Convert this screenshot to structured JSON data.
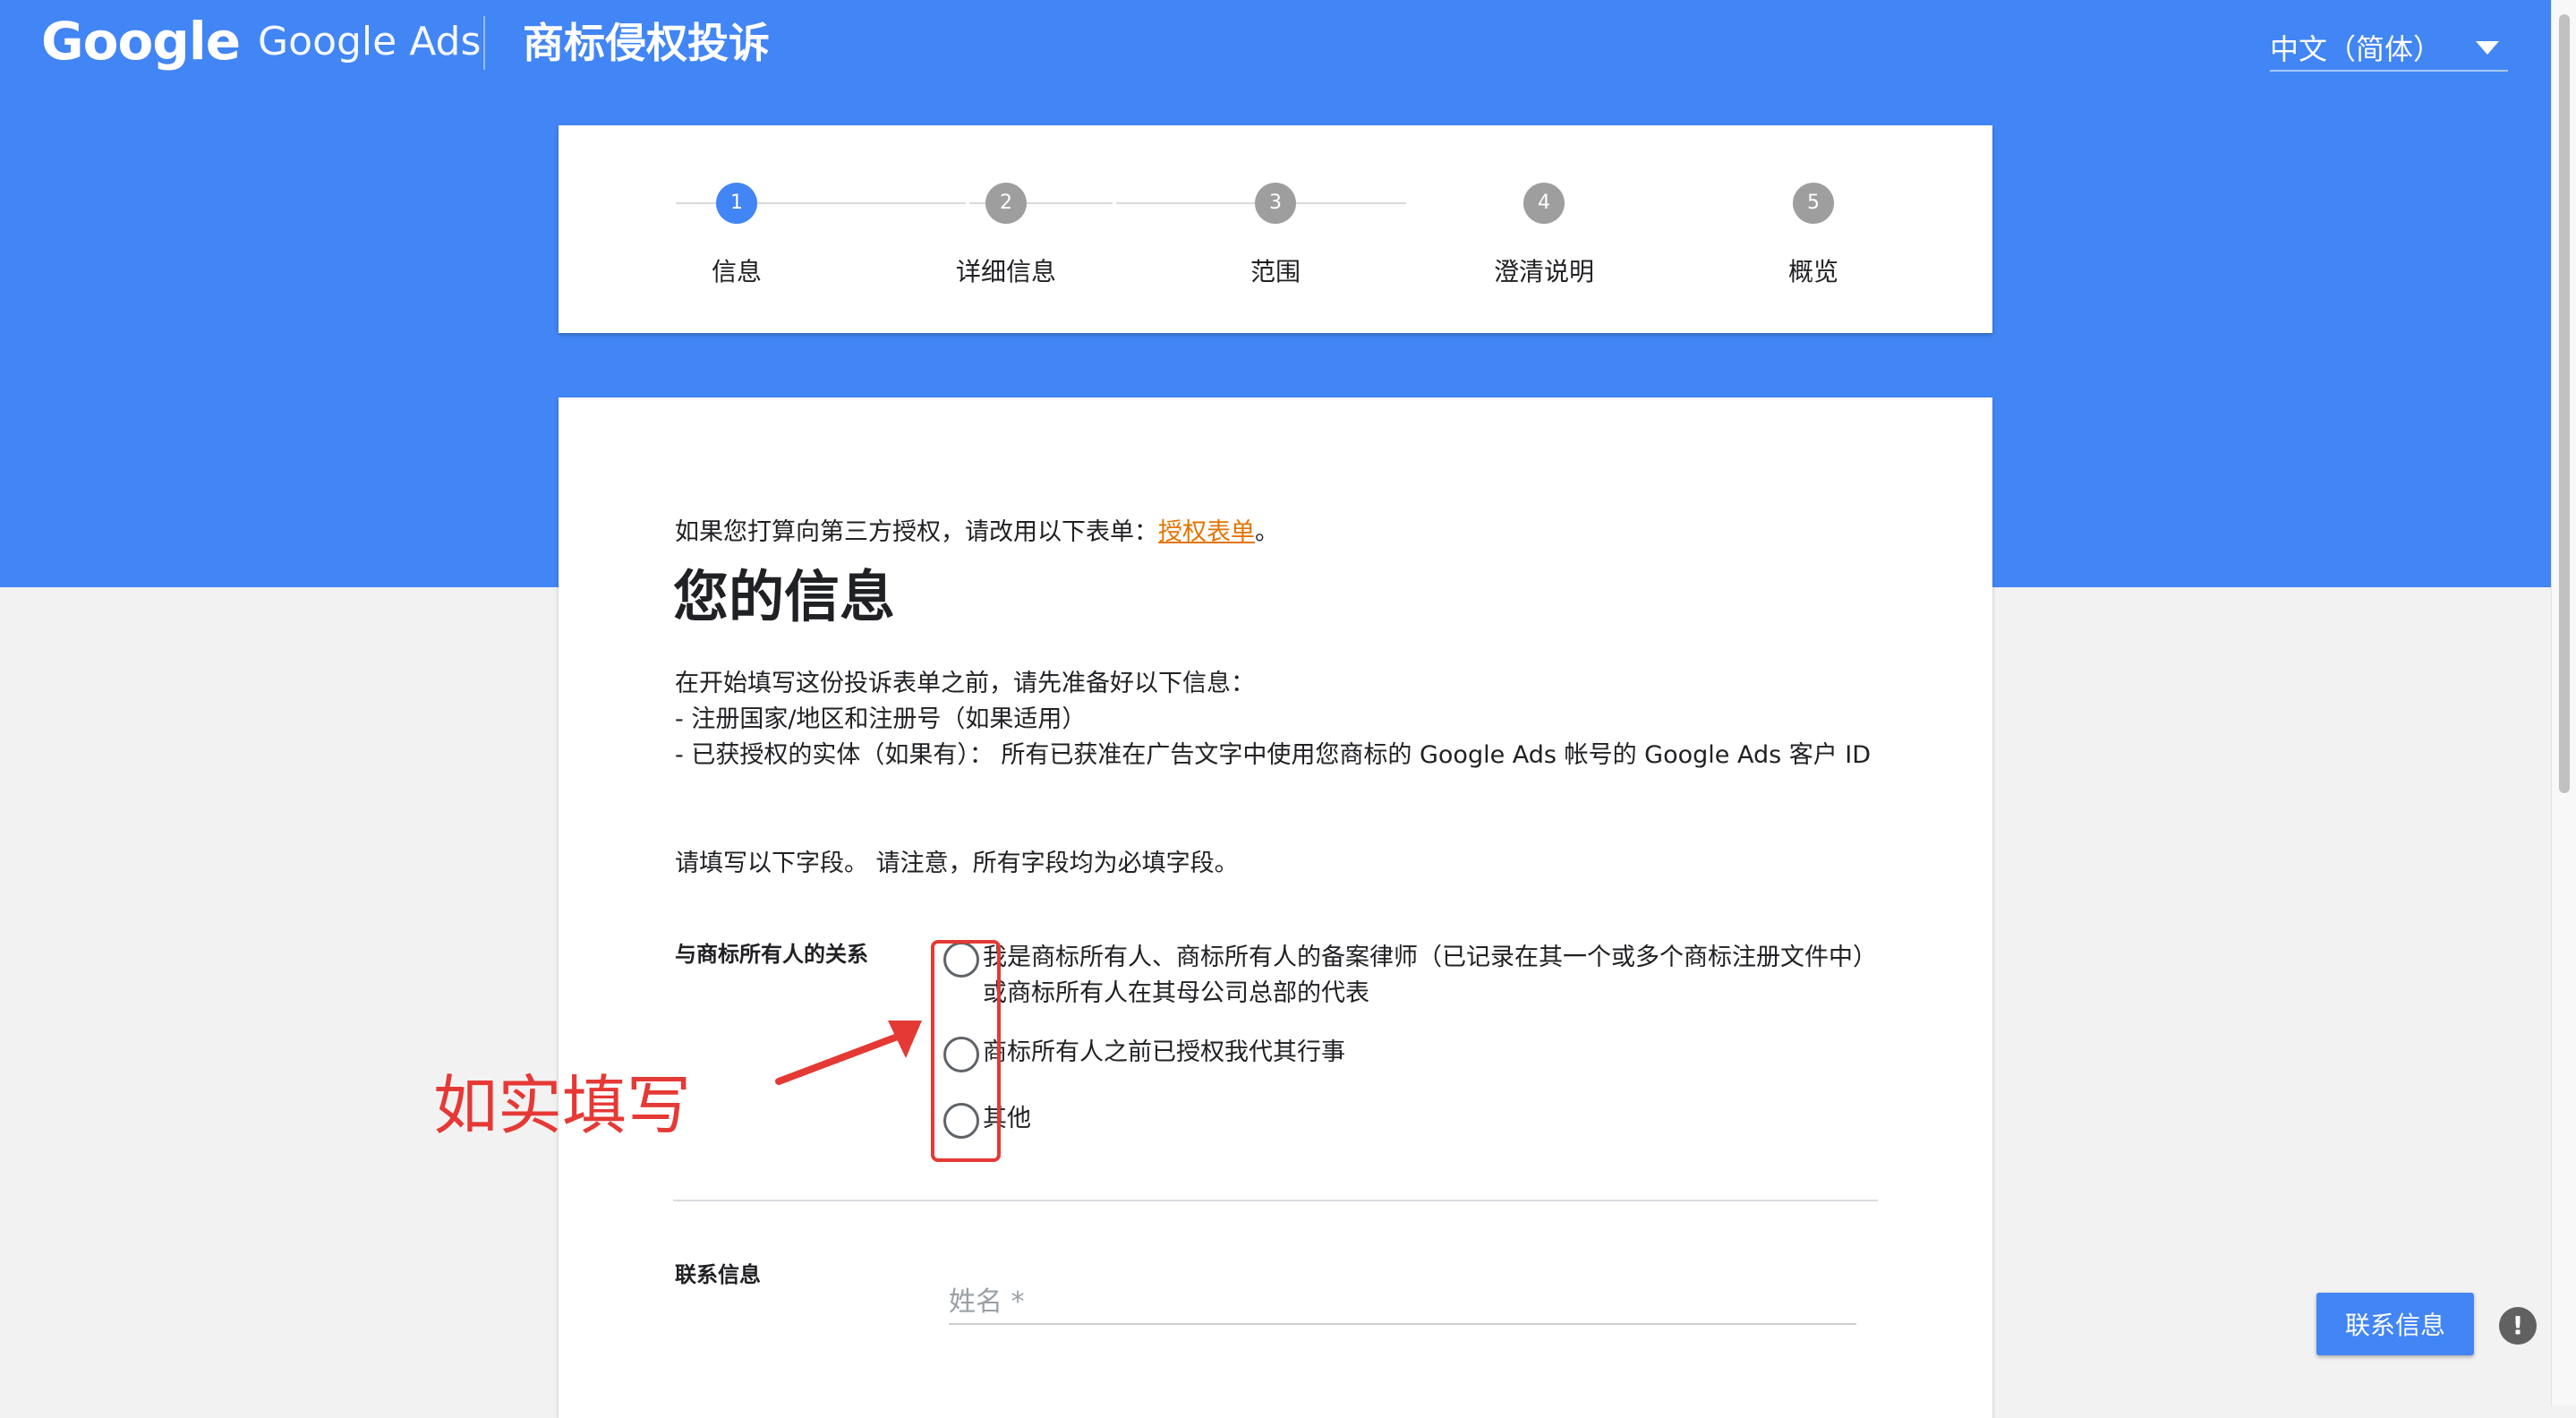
{
  "header": {
    "brand_google": "Google",
    "brand_ads": "Google Ads",
    "title": "商标侵权投诉",
    "language": "中文（简体）"
  },
  "stepper": {
    "steps": [
      {
        "number": "1",
        "label": "信息",
        "active": true
      },
      {
        "number": "2",
        "label": "详细信息",
        "active": false
      },
      {
        "number": "3",
        "label": "范围",
        "active": false
      },
      {
        "number": "4",
        "label": "澄清说明",
        "active": false
      },
      {
        "number": "5",
        "label": "概览",
        "active": false
      }
    ]
  },
  "form": {
    "intro_text": "如果您打算向第三方授权，请改用以下表单：",
    "intro_link": "授权表单",
    "intro_end": "。",
    "title": "您的信息",
    "prep_lines": [
      "在开始填写这份投诉表单之前，请先准备好以下信息：",
      "- 注册国家/地区和注册号（如果适用）",
      "- 已获授权的实体（如果有）： 所有已获准在广告文字中使用您商标的 Google Ads 帐号的 Google Ads 客户 ID"
    ],
    "fill_note": "请填写以下字段。 请注意，所有字段均为必填字段。",
    "relationship_label": "与商标所有人的关系",
    "relationship_options": [
      "我是商标所有人、商标所有人的备案律师（已记录在其一个或多个商标注册文件中）或商标所有人在其母公司总部的代表",
      "商标所有人之前已授权我代其行事",
      "其他"
    ],
    "contact_label": "联系信息",
    "name_placeholder": "姓名 *"
  },
  "annotation": {
    "text": "如实填写",
    "color": "#e53935"
  },
  "floating": {
    "contact_button": "联系信息",
    "feedback_icon": "!"
  },
  "colors": {
    "primary": "#4285f4",
    "link": "#e37400",
    "annotation": "#e53935"
  }
}
